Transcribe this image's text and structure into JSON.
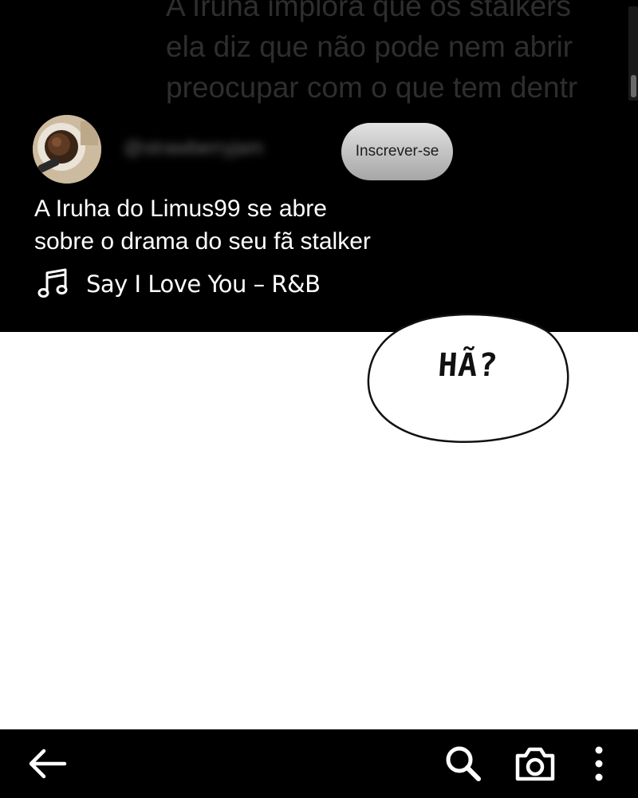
{
  "caption": {
    "lines": [
      "A Iruha implora que os stalkers",
      "ela diz que não pode nem abrir",
      "preocupar com o que tem dentr"
    ]
  },
  "channel": {
    "handle": "@strawberryjam",
    "subscribe_label": "Inscrever-se"
  },
  "video": {
    "title_lines": [
      "A Iruha do Limus99 se abre",
      "sobre o drama do seu fã stalker"
    ],
    "song": "Say I Love You – R&B"
  },
  "speech_bubble": {
    "text": "HÃ?"
  },
  "nav": {
    "icons": [
      "back-arrow-icon",
      "search-icon",
      "camera-icon",
      "more-vert-icon"
    ]
  }
}
